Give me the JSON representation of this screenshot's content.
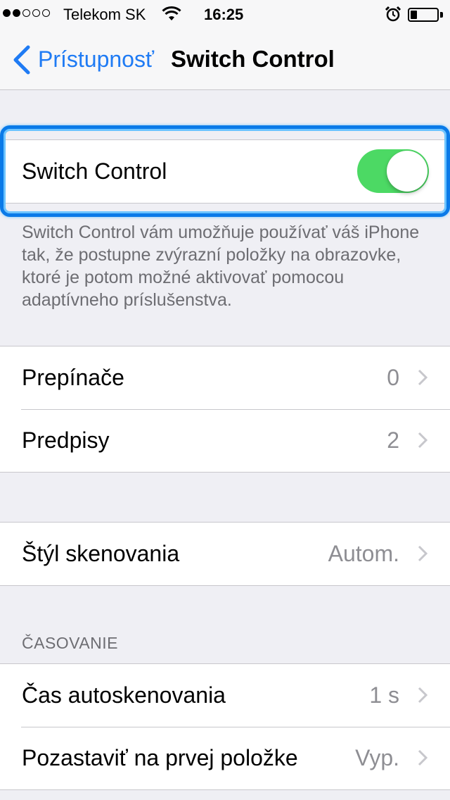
{
  "status_bar": {
    "signal_filled": 2,
    "signal_total": 5,
    "carrier": "Telekom SK",
    "time": "16:25",
    "battery_level": 0.25
  },
  "nav": {
    "back_label": "Prístupnosť",
    "title": "Switch Control"
  },
  "main_toggle": {
    "label": "Switch Control",
    "on": true,
    "on_color": "#4cd964"
  },
  "description": "Switch Control vám umožňuje používať váš iPhone tak, že postupne zvýrazní položky na obrazovke, ktoré je potom možné aktivovať pomocou adaptívneho príslušenstva.",
  "group1": [
    {
      "label": "Prepínače",
      "value": "0"
    },
    {
      "label": "Predpisy",
      "value": "2"
    }
  ],
  "group2": [
    {
      "label": "Štýl skenovania",
      "value": "Autom."
    }
  ],
  "timing": {
    "header": "ČASOVANIE",
    "items": [
      {
        "label": "Čas autoskenovania",
        "value": "1 s"
      },
      {
        "label": "Pozastaviť na prvej položke",
        "value": "Vyp."
      }
    ]
  },
  "colors": {
    "accent": "#1f7bf4",
    "focus_ring": "#0a7ae8",
    "background": "#efeff4"
  },
  "icons": {
    "back": "chevron-left-icon",
    "disclosure": "chevron-right-icon",
    "wifi": "wifi-icon",
    "alarm": "alarm-icon",
    "battery": "battery-icon"
  }
}
